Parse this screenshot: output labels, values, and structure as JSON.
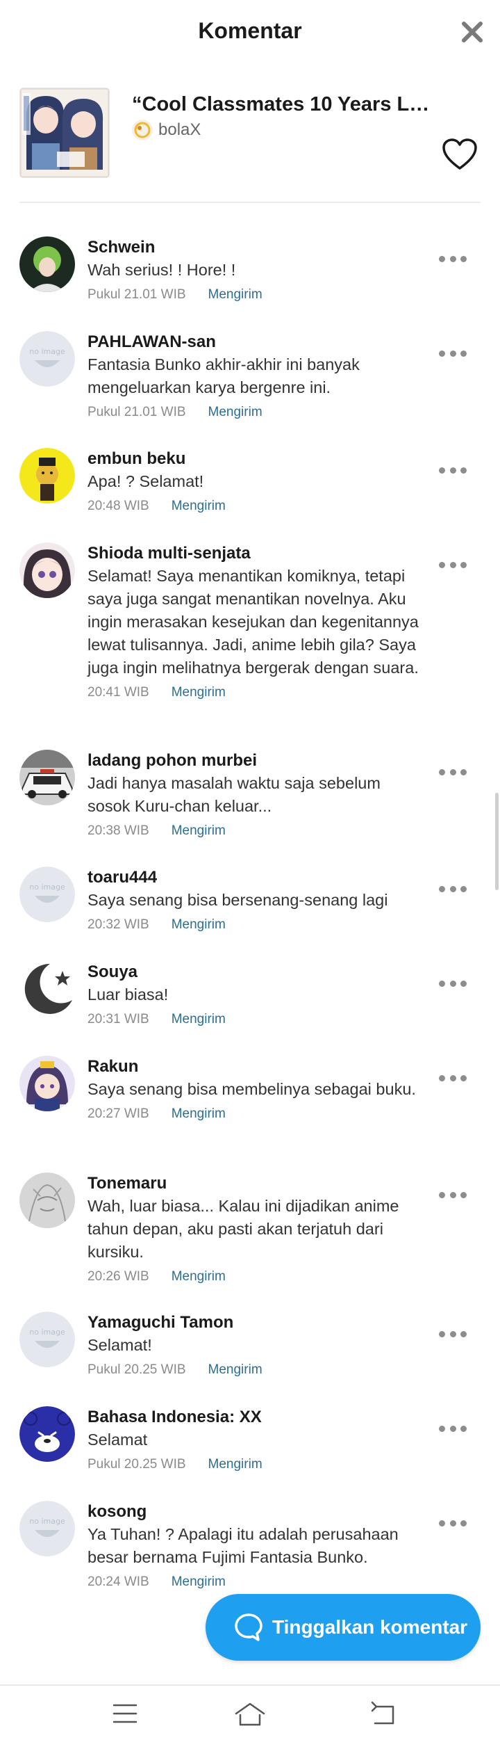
{
  "header": {
    "title": "Komentar",
    "close_icon": "close-icon"
  },
  "book": {
    "title": "“Cool Classmates 10 Years Lat…",
    "author": "bolaX",
    "favorite_icon": "heart-outline-icon",
    "cover_icon": "book-cover-image"
  },
  "comments": [
    {
      "name": "Schwein",
      "text": "Wah serius! ! Hore! !",
      "time": "Pukul 21.01 WIB",
      "action": "Mengirim",
      "avatar": "green-hair-avatar"
    },
    {
      "name": "PAHLAWAN-san",
      "text": "Fantasia Bunko akhir-akhir ini banyak mengeluarkan karya bergenre ini.",
      "time": "Pukul 21.01 WIB",
      "action": "Mengirim",
      "avatar": "no-image-avatar"
    },
    {
      "name": "embun beku",
      "text": "Apa! ? Selamat!",
      "time": "20:48 WIB",
      "action": "Mengirim",
      "avatar": "yellow-character-avatar"
    },
    {
      "name": "Shioda multi-senjata",
      "text": "Selamat! Saya menantikan komiknya, tetapi saya juga sangat menantikan novelnya. Aku ingin merasakan kesejukan dan kegenitannya lewat tulisannya. Jadi, anime lebih gila? Saya juga ingin melihatnya bergerak dengan suara.",
      "time": "20:41 WIB",
      "action": "Mengirim",
      "avatar": "anime-girl-avatar"
    },
    {
      "name": "ladang pohon murbei",
      "text": "Jadi hanya masalah waktu saja sebelum sosok Kuru-chan keluar...",
      "time": "20:38 WIB",
      "action": "Mengirim",
      "avatar": "car-photo-avatar"
    },
    {
      "name": "toaru444",
      "text": "Saya senang bisa bersenang-senang lagi",
      "time": "20:32 WIB",
      "action": "Mengirim",
      "avatar": "no-image-avatar"
    },
    {
      "name": "Souya",
      "text": "Luar biasa!",
      "time": "20:31 WIB",
      "action": "Mengirim",
      "avatar": "moon-star-avatar"
    },
    {
      "name": "Rakun",
      "text": "Saya senang bisa membelinya sebagai buku.",
      "time": "20:27 WIB",
      "action": "Mengirim",
      "avatar": "anime-character-avatar"
    },
    {
      "name": "Tonemaru",
      "text": "Wah, luar biasa... Kalau ini dijadikan anime tahun depan, aku pasti akan terjatuh dari kursiku.",
      "time": "20:26 WIB",
      "action": "Mengirim",
      "avatar": "sketch-avatar"
    },
    {
      "name": "Yamaguchi Tamon",
      "text": "Selamat!",
      "time": "Pukul 20.25 WIB",
      "action": "Mengirim",
      "avatar": "no-image-avatar"
    },
    {
      "name": "Bahasa Indonesia: XX",
      "text": "Selamat",
      "time": "Pukul 20.25 WIB",
      "action": "Mengirim",
      "avatar": "blue-bear-avatar"
    },
    {
      "name": "kosong",
      "text": "Ya Tuhan! ? Apalagi itu adalah perusahaan besar bernama Fujimi Fantasia Bunko.",
      "time": "20:24 WIB",
      "action": "Mengirim",
      "avatar": "no-image-avatar"
    }
  ],
  "compose_button": {
    "label": "Tinggalkan komentar",
    "icon": "chat-bubble-icon"
  },
  "nav": {
    "menu_icon": "menu-icon",
    "home_icon": "home-icon",
    "back_icon": "back-icon"
  },
  "colors": {
    "accent": "#1e9ff0",
    "link": "#2c6e92",
    "muted": "#8a8a8a"
  }
}
